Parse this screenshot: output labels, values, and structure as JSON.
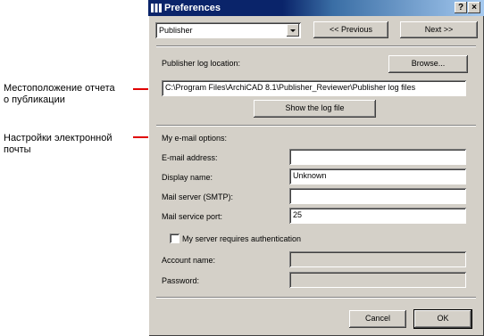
{
  "annotations": {
    "report_location": [
      "Местоположение отчета",
      "о публикации"
    ],
    "email_settings": [
      "Настройки электронной",
      "почты"
    ]
  },
  "window": {
    "title": "Preferences",
    "help_button": "?",
    "close_button": "×"
  },
  "nav": {
    "dropdown_value": "Publisher",
    "previous": "<< Previous",
    "next": "Next >>"
  },
  "log": {
    "location_label": "Publisher log location:",
    "browse": "Browse...",
    "path": "C:\\Program Files\\ArchiCAD 8.1\\Publisher_Reviewer\\Publisher log files",
    "show_log": "Show the log file"
  },
  "email": {
    "section_label": "My e-mail options:",
    "address_label": "E-mail address:",
    "address_value": "",
    "display_name_label": "Display name:",
    "display_name_value": "Unknown",
    "smtp_label": "Mail server (SMTP):",
    "smtp_value": "",
    "port_label": "Mail service port:",
    "port_value": "25",
    "auth_label": "My server requires authentication",
    "auth_checked": false,
    "account_label": "Account name:",
    "account_value": "",
    "password_label": "Password:",
    "password_value": ""
  },
  "footer": {
    "cancel": "Cancel",
    "ok": "OK"
  },
  "colors": {
    "annotation_arrow": "#e00000",
    "title_bar": "#0a246a",
    "dialog_face": "#d4d0c8"
  }
}
